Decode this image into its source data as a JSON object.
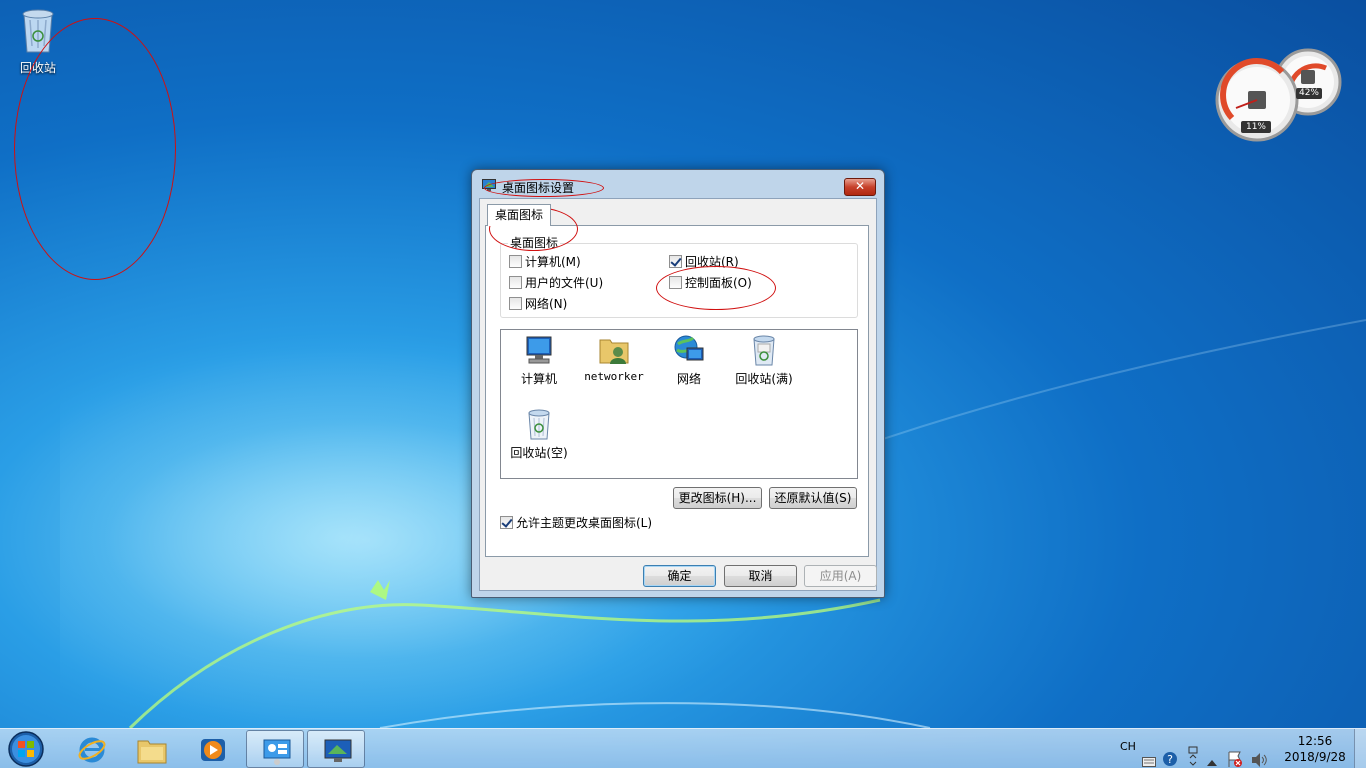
{
  "desktop": {
    "icons": [
      {
        "label": "回收站",
        "icon": "recycle-bin-icon"
      }
    ]
  },
  "gadget": {
    "cpu_percent": "11%",
    "mem_percent": "42%"
  },
  "dialog": {
    "title": "桌面图标设置",
    "close_label": "✕",
    "tab_label": "桌面图标",
    "group_title": "桌面图标",
    "checkboxes": [
      {
        "label": "计算机(M)",
        "checked": false
      },
      {
        "label": "回收站(R)",
        "checked": true
      },
      {
        "label": "用户的文件(U)",
        "checked": false
      },
      {
        "label": "控制面板(O)",
        "checked": false
      },
      {
        "label": "网络(N)",
        "checked": false
      }
    ],
    "icon_list": [
      {
        "label": "计算机",
        "icon": "computer-icon"
      },
      {
        "label": "networker",
        "icon": "user-folder-icon"
      },
      {
        "label": "网络",
        "icon": "network-icon"
      },
      {
        "label": "回收站(满)",
        "icon": "recycle-bin-full-icon"
      },
      {
        "label": "回收站(空)",
        "icon": "recycle-bin-empty-icon"
      }
    ],
    "change_icon_button": "更改图标(H)...",
    "restore_default_button": "还原默认值(S)",
    "allow_theme_label": "允许主题更改桌面图标(L)",
    "allow_theme_checked": true,
    "ok_button": "确定",
    "cancel_button": "取消",
    "apply_button": "应用(A)"
  },
  "taskbar": {
    "pinned": [
      "start-orb",
      "internet-explorer-icon",
      "windows-explorer-icon",
      "media-player-icon",
      "desktop-gadgets-icon",
      "desktop-icon-settings-icon"
    ],
    "tray": {
      "language": "CH",
      "time": "12:56",
      "date": "2018/9/28"
    }
  },
  "colors": {
    "annotation_red": "#d01010",
    "desktop_blue": "#0f6fc6",
    "close_red": "#c7412b"
  }
}
